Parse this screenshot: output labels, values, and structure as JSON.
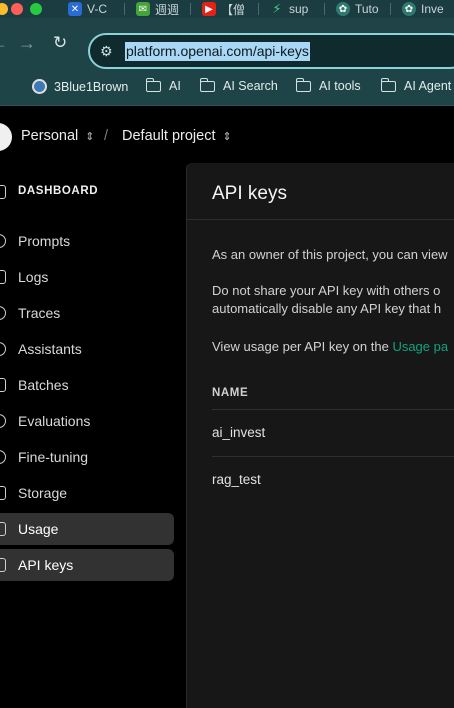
{
  "browser": {
    "tabs": [
      {
        "label": "V-C",
        "icon": "v-icon",
        "color": "#2a6bd6"
      },
      {
        "label": "週週",
        "icon": "mail-icon",
        "color": "#45a33b"
      },
      {
        "label": "【僧",
        "icon": "youtube-icon",
        "color": "#e62117"
      },
      {
        "label": "sup",
        "icon": "bolt-icon",
        "color": "#3ecf8e"
      },
      {
        "label": "Tuto",
        "icon": "openai-icon",
        "color": "#2f7a70"
      },
      {
        "label": "Inve",
        "icon": "openai-icon",
        "color": "#2f7a70"
      }
    ],
    "url": "platform.openai.com/api-keys",
    "bookmarks": [
      {
        "label": "3Blue1Brown",
        "icon": "3b1b-icon"
      },
      {
        "label": "AI",
        "icon": "folder-icon"
      },
      {
        "label": "AI Search",
        "icon": "folder-icon"
      },
      {
        "label": "AI tools",
        "icon": "folder-icon"
      },
      {
        "label": "AI Agent",
        "icon": "folder-icon"
      }
    ]
  },
  "header": {
    "org": "Personal",
    "separator": "/",
    "project": "Default project"
  },
  "sidebar": {
    "section": "DASHBOARD",
    "items": [
      {
        "label": "Prompts",
        "icon": "prompts-icon"
      },
      {
        "label": "Logs",
        "icon": "logs-icon"
      },
      {
        "label": "Traces",
        "icon": "traces-icon"
      },
      {
        "label": "Assistants",
        "icon": "assistants-icon"
      },
      {
        "label": "Batches",
        "icon": "batches-icon"
      },
      {
        "label": "Evaluations",
        "icon": "evaluations-icon"
      },
      {
        "label": "Fine-tuning",
        "icon": "fine-tuning-icon"
      },
      {
        "label": "Storage",
        "icon": "storage-icon"
      },
      {
        "label": "Usage",
        "icon": "usage-icon"
      },
      {
        "label": "API keys",
        "icon": "lock-icon",
        "active": true
      }
    ]
  },
  "main": {
    "title": "API keys",
    "intro": "As an owner of this project, you can view",
    "warning_line1": "Do not share your API key with others o",
    "warning_line2": "automatically disable any API key that h",
    "usage_prefix": "View usage per API key on the ",
    "usage_link": "Usage pa",
    "table": {
      "column": "NAME",
      "rows": [
        "ai_invest",
        "rag_test"
      ]
    }
  },
  "colors": {
    "accent": "#10a37f",
    "selected_bg": "#323232",
    "panel_bg": "#171717"
  }
}
